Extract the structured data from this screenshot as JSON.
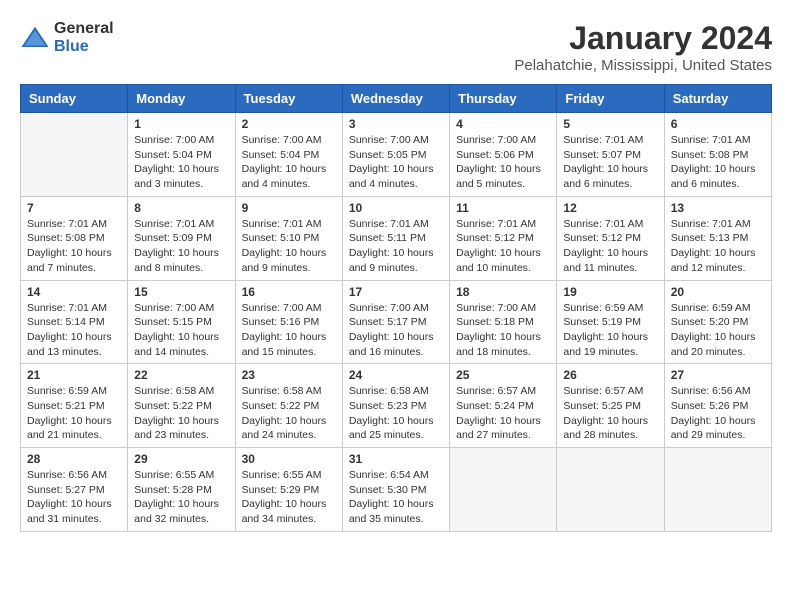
{
  "logo": {
    "general": "General",
    "blue": "Blue"
  },
  "title": "January 2024",
  "subtitle": "Pelahatchie, Mississippi, United States",
  "days_of_week": [
    "Sunday",
    "Monday",
    "Tuesday",
    "Wednesday",
    "Thursday",
    "Friday",
    "Saturday"
  ],
  "weeks": [
    [
      {
        "day": "",
        "sunrise": "",
        "sunset": "",
        "daylight": "",
        "empty": true
      },
      {
        "day": "1",
        "sunrise": "Sunrise: 7:00 AM",
        "sunset": "Sunset: 5:04 PM",
        "daylight": "Daylight: 10 hours and 3 minutes."
      },
      {
        "day": "2",
        "sunrise": "Sunrise: 7:00 AM",
        "sunset": "Sunset: 5:04 PM",
        "daylight": "Daylight: 10 hours and 4 minutes."
      },
      {
        "day": "3",
        "sunrise": "Sunrise: 7:00 AM",
        "sunset": "Sunset: 5:05 PM",
        "daylight": "Daylight: 10 hours and 4 minutes."
      },
      {
        "day": "4",
        "sunrise": "Sunrise: 7:00 AM",
        "sunset": "Sunset: 5:06 PM",
        "daylight": "Daylight: 10 hours and 5 minutes."
      },
      {
        "day": "5",
        "sunrise": "Sunrise: 7:01 AM",
        "sunset": "Sunset: 5:07 PM",
        "daylight": "Daylight: 10 hours and 6 minutes."
      },
      {
        "day": "6",
        "sunrise": "Sunrise: 7:01 AM",
        "sunset": "Sunset: 5:08 PM",
        "daylight": "Daylight: 10 hours and 6 minutes."
      }
    ],
    [
      {
        "day": "7",
        "sunrise": "Sunrise: 7:01 AM",
        "sunset": "Sunset: 5:08 PM",
        "daylight": "Daylight: 10 hours and 7 minutes."
      },
      {
        "day": "8",
        "sunrise": "Sunrise: 7:01 AM",
        "sunset": "Sunset: 5:09 PM",
        "daylight": "Daylight: 10 hours and 8 minutes."
      },
      {
        "day": "9",
        "sunrise": "Sunrise: 7:01 AM",
        "sunset": "Sunset: 5:10 PM",
        "daylight": "Daylight: 10 hours and 9 minutes."
      },
      {
        "day": "10",
        "sunrise": "Sunrise: 7:01 AM",
        "sunset": "Sunset: 5:11 PM",
        "daylight": "Daylight: 10 hours and 9 minutes."
      },
      {
        "day": "11",
        "sunrise": "Sunrise: 7:01 AM",
        "sunset": "Sunset: 5:12 PM",
        "daylight": "Daylight: 10 hours and 10 minutes."
      },
      {
        "day": "12",
        "sunrise": "Sunrise: 7:01 AM",
        "sunset": "Sunset: 5:12 PM",
        "daylight": "Daylight: 10 hours and 11 minutes."
      },
      {
        "day": "13",
        "sunrise": "Sunrise: 7:01 AM",
        "sunset": "Sunset: 5:13 PM",
        "daylight": "Daylight: 10 hours and 12 minutes."
      }
    ],
    [
      {
        "day": "14",
        "sunrise": "Sunrise: 7:01 AM",
        "sunset": "Sunset: 5:14 PM",
        "daylight": "Daylight: 10 hours and 13 minutes."
      },
      {
        "day": "15",
        "sunrise": "Sunrise: 7:00 AM",
        "sunset": "Sunset: 5:15 PM",
        "daylight": "Daylight: 10 hours and 14 minutes."
      },
      {
        "day": "16",
        "sunrise": "Sunrise: 7:00 AM",
        "sunset": "Sunset: 5:16 PM",
        "daylight": "Daylight: 10 hours and 15 minutes."
      },
      {
        "day": "17",
        "sunrise": "Sunrise: 7:00 AM",
        "sunset": "Sunset: 5:17 PM",
        "daylight": "Daylight: 10 hours and 16 minutes."
      },
      {
        "day": "18",
        "sunrise": "Sunrise: 7:00 AM",
        "sunset": "Sunset: 5:18 PM",
        "daylight": "Daylight: 10 hours and 18 minutes."
      },
      {
        "day": "19",
        "sunrise": "Sunrise: 6:59 AM",
        "sunset": "Sunset: 5:19 PM",
        "daylight": "Daylight: 10 hours and 19 minutes."
      },
      {
        "day": "20",
        "sunrise": "Sunrise: 6:59 AM",
        "sunset": "Sunset: 5:20 PM",
        "daylight": "Daylight: 10 hours and 20 minutes."
      }
    ],
    [
      {
        "day": "21",
        "sunrise": "Sunrise: 6:59 AM",
        "sunset": "Sunset: 5:21 PM",
        "daylight": "Daylight: 10 hours and 21 minutes."
      },
      {
        "day": "22",
        "sunrise": "Sunrise: 6:58 AM",
        "sunset": "Sunset: 5:22 PM",
        "daylight": "Daylight: 10 hours and 23 minutes."
      },
      {
        "day": "23",
        "sunrise": "Sunrise: 6:58 AM",
        "sunset": "Sunset: 5:22 PM",
        "daylight": "Daylight: 10 hours and 24 minutes."
      },
      {
        "day": "24",
        "sunrise": "Sunrise: 6:58 AM",
        "sunset": "Sunset: 5:23 PM",
        "daylight": "Daylight: 10 hours and 25 minutes."
      },
      {
        "day": "25",
        "sunrise": "Sunrise: 6:57 AM",
        "sunset": "Sunset: 5:24 PM",
        "daylight": "Daylight: 10 hours and 27 minutes."
      },
      {
        "day": "26",
        "sunrise": "Sunrise: 6:57 AM",
        "sunset": "Sunset: 5:25 PM",
        "daylight": "Daylight: 10 hours and 28 minutes."
      },
      {
        "day": "27",
        "sunrise": "Sunrise: 6:56 AM",
        "sunset": "Sunset: 5:26 PM",
        "daylight": "Daylight: 10 hours and 29 minutes."
      }
    ],
    [
      {
        "day": "28",
        "sunrise": "Sunrise: 6:56 AM",
        "sunset": "Sunset: 5:27 PM",
        "daylight": "Daylight: 10 hours and 31 minutes."
      },
      {
        "day": "29",
        "sunrise": "Sunrise: 6:55 AM",
        "sunset": "Sunset: 5:28 PM",
        "daylight": "Daylight: 10 hours and 32 minutes."
      },
      {
        "day": "30",
        "sunrise": "Sunrise: 6:55 AM",
        "sunset": "Sunset: 5:29 PM",
        "daylight": "Daylight: 10 hours and 34 minutes."
      },
      {
        "day": "31",
        "sunrise": "Sunrise: 6:54 AM",
        "sunset": "Sunset: 5:30 PM",
        "daylight": "Daylight: 10 hours and 35 minutes."
      },
      {
        "day": "",
        "sunrise": "",
        "sunset": "",
        "daylight": "",
        "empty": true
      },
      {
        "day": "",
        "sunrise": "",
        "sunset": "",
        "daylight": "",
        "empty": true
      },
      {
        "day": "",
        "sunrise": "",
        "sunset": "",
        "daylight": "",
        "empty": true
      }
    ]
  ]
}
